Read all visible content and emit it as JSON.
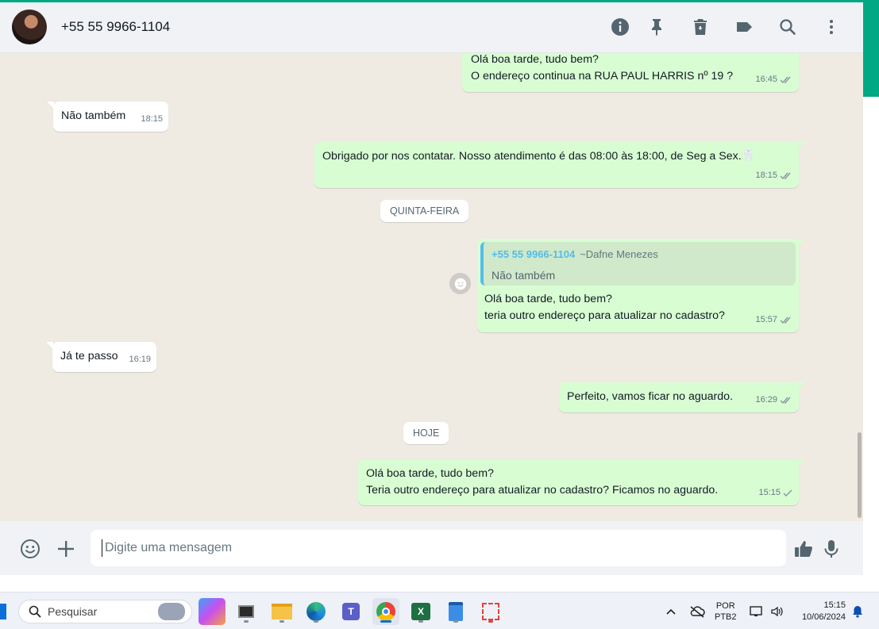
{
  "header": {
    "contact": "+55 55 9966-1104",
    "icons": [
      "info-icon",
      "pin-icon",
      "trash-icon",
      "label-icon",
      "search-icon",
      "menu-icon"
    ]
  },
  "messages": [
    {
      "dir": "out",
      "lines": [
        "Olá boa tarde, tudo bem?",
        "O endereço continua na RUA PAUL HARRIS nº 19 ?"
      ],
      "time": "16:45",
      "status": "read"
    },
    {
      "dir": "in",
      "lines": [
        "Não também"
      ],
      "time": "18:15"
    },
    {
      "dir": "out",
      "lines": [
        "Obrigado por nos contatar. Nosso atendimento é das 08:00 às 18:00, de Seg a Sex.🦷"
      ],
      "time": "18:15",
      "status": "read"
    },
    {
      "dir": "out",
      "quote": {
        "number": "+55 55 9966-1104",
        "alias": "~Dafne Menezes",
        "text": "Não também"
      },
      "lines": [
        "Olá boa tarde, tudo bem?",
        "teria outro endereço para atualizar no cadastro?"
      ],
      "time": "15:57",
      "status": "read"
    },
    {
      "dir": "in",
      "lines": [
        "Já te passo"
      ],
      "time": "16:19"
    },
    {
      "dir": "out",
      "lines": [
        "Perfeito, vamos ficar no aguardo."
      ],
      "time": "16:29",
      "status": "read"
    },
    {
      "dir": "out",
      "lines": [
        "Olá boa tarde, tudo bem?",
        "Teria outro endereço para atualizar no cadastro? Ficamos no aguardo."
      ],
      "time": "15:15",
      "status": "sent"
    }
  ],
  "day_separators": [
    "QUINTA-FEIRA",
    "HOJE"
  ],
  "composer": {
    "placeholder": "Digite uma mensagem",
    "icons": [
      "emoji-icon",
      "plus-icon",
      "thumbs-up-icon",
      "microphone-icon"
    ]
  },
  "taskbar": {
    "search_placeholder": "Pesquisar",
    "apps": [
      "copilot-pre",
      "file-explorer",
      "folder",
      "edge",
      "teams",
      "chrome",
      "excel",
      "notepad",
      "snipping-tool"
    ],
    "active_app": "chrome",
    "language_line1": "POR",
    "language_line2": "PTB2",
    "time": "15:15",
    "date": "10/06/2024"
  },
  "colors": {
    "accent": "#00a884",
    "outgoing_bubble": "#d9fdd3",
    "incoming_bubble": "#ffffff",
    "chat_background": "#efeae2",
    "quote_bar": "#53bdeb"
  }
}
